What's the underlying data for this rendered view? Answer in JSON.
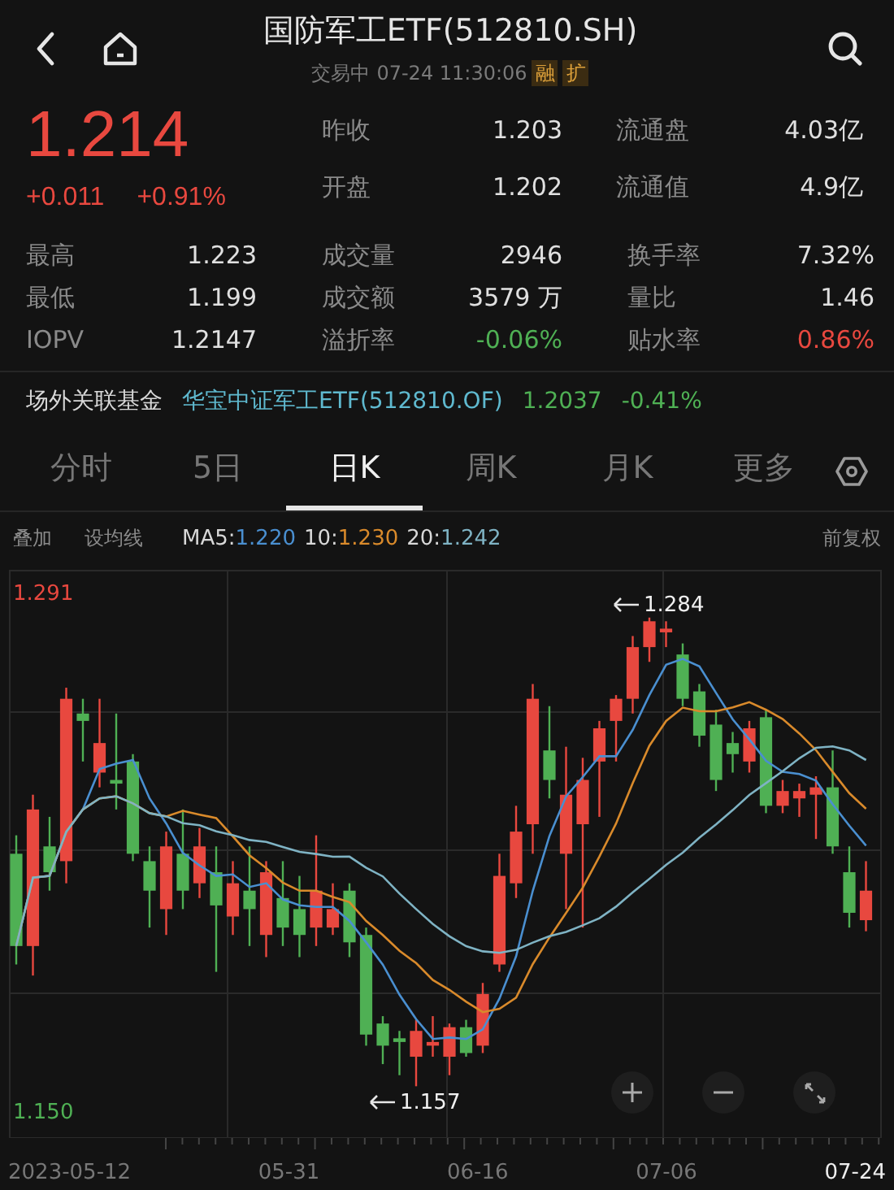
{
  "header": {
    "title": "国防军工ETF(512810.SH)",
    "status": "交易中",
    "time": "07-24 11:30:06",
    "badges": [
      "融",
      "扩"
    ]
  },
  "quote": {
    "price": "1.214",
    "change": "+0.011",
    "change_pct": "+0.91%"
  },
  "top_stats": [
    {
      "label": "昨收",
      "value": "1.203"
    },
    {
      "label": "流通盘",
      "value": "4.03亿"
    },
    {
      "label": "开盘",
      "value": "1.202"
    },
    {
      "label": "流通值",
      "value": "4.9亿"
    }
  ],
  "stats": [
    {
      "label": "最高",
      "value": "1.223",
      "color": "#e0e0e0"
    },
    {
      "label": "成交量",
      "value": "2946",
      "color": "#e0e0e0"
    },
    {
      "label": "换手率",
      "value": "7.32%",
      "color": "#e0e0e0"
    },
    {
      "label": "最低",
      "value": "1.199",
      "color": "#e0e0e0"
    },
    {
      "label": "成交额",
      "value": "3579 万",
      "color": "#e0e0e0"
    },
    {
      "label": "量比",
      "value": "1.46",
      "color": "#e0e0e0"
    },
    {
      "label": "IOPV",
      "value": "1.2147",
      "color": "#e0e0e0"
    },
    {
      "label": "溢折率",
      "value": "-0.06%",
      "color": "#4fb054"
    },
    {
      "label": "贴水率",
      "value": "0.86%",
      "color": "#e8483f"
    }
  ],
  "related_fund": {
    "label": "场外关联基金",
    "name": "华宝中证军工ETF(512810.OF)",
    "price": "1.2037",
    "change": "-0.41%"
  },
  "tabs": [
    {
      "label": "分时",
      "selected": false
    },
    {
      "label": "5日",
      "selected": false
    },
    {
      "label": "日K",
      "selected": true
    },
    {
      "label": "周K",
      "selected": false
    },
    {
      "label": "月K",
      "selected": false
    },
    {
      "label": "更多",
      "selected": false
    }
  ],
  "indicator_bar": {
    "overlay": "叠加",
    "ma_setting": "设均线",
    "adjust": "前复权",
    "ma": [
      {
        "name": "MA5:",
        "value": "1.220",
        "color": "#4a8fd0"
      },
      {
        "name": "10:",
        "value": "1.230",
        "color": "#d98a2b"
      },
      {
        "name": "20:",
        "value": "1.242",
        "color": "#7fb3c4"
      }
    ]
  },
  "chart": {
    "max_label": "1.291",
    "min_label": "1.150",
    "high_mark": "1.284",
    "low_mark": "1.157",
    "dates": [
      {
        "label": "2023-05-12",
        "selected": false
      },
      {
        "label": "05-31",
        "selected": false
      },
      {
        "label": "06-16",
        "selected": false
      },
      {
        "label": "07-06",
        "selected": false
      },
      {
        "label": "07-24",
        "selected": true
      }
    ]
  }
}
